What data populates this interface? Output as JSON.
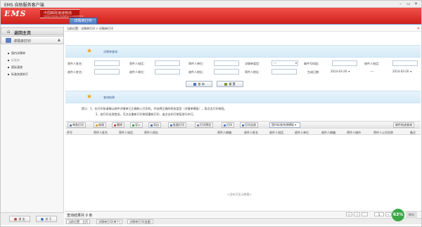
{
  "window": {
    "title": "EMS 自助服务客户端",
    "controls": [
      "–",
      "▭",
      "✕"
    ]
  },
  "header": {
    "logo_text": "EMS",
    "logo_cn": "中国邮政速递物流",
    "logo_en": "CHINA POSTAL EXPRESS & LOGISTICS",
    "main_tab": "详情单打印"
  },
  "sidebar": {
    "home_label": "返回主页",
    "section_label": "详情单打印",
    "items": [
      {
        "label": "国内详情单"
      },
      {
        "label": "标准快"
      },
      {
        "label": "国际速递"
      },
      {
        "label": "标准快递补打"
      }
    ],
    "exit_label": "退 出",
    "about_label": "关 于"
  },
  "breadcrumb": {
    "text": "当前位置：详情单打印 > 详情单打印"
  },
  "query_panel": {
    "title": "详情单查询"
  },
  "form": {
    "row1": [
      {
        "label": "寄件人姓名："
      },
      {
        "label": "寄件人电话："
      },
      {
        "label": "寄件人单位："
      },
      {
        "label": "详情单类型：",
        "select_value": "---"
      },
      {
        "label": "邮件号码段："
      },
      {
        "label": "收件人电话："
      }
    ],
    "row2": [
      {
        "label": "收件人姓名："
      },
      {
        "label": "收件人单位："
      },
      {
        "label": "收件人地址："
      },
      {
        "label": "寄件人地址："
      },
      {
        "label": "生成日期：",
        "date_from": "2014-03-26",
        "separator": "----",
        "date_to": "2014-03-26"
      }
    ],
    "query_label": "查 询",
    "reset_label": "重 置"
  },
  "list_panel": {
    "title": "查询结果"
  },
  "notice": {
    "line1": "提示：1、在打印前请确认邮件详情单已正确装入打印机，并选择正确的纸张类型（详情单模板），再点击打印按钮。",
    "line2": "2、若打印出现错误，可点击重新打印按钮重新打印，或点击补打按钮进行补打。"
  },
  "toolbar": {
    "buttons": [
      "单条打印",
      "修改",
      "删除",
      "导入",
      "导出",
      "批量打印",
      "打印预览",
      "打印",
      "打印全部"
    ],
    "template_select": "国内标准快递模板",
    "right_button": "邮件轨迹查询"
  },
  "grid": {
    "columns": [
      "序号",
      "寄件人姓名",
      "寄件人电话",
      "寄件人地址",
      "寄件人邮编",
      "收件人姓名",
      "收件人电话",
      "收件人单位",
      "收件人邮编",
      "寄件人城市",
      "寄件人公司名称",
      "备注"
    ],
    "empty_text": "<没有可显示数据>"
  },
  "status": {
    "text": "查询结果共 0 条",
    "page": "1"
  },
  "bottom_tabs": [
    "当前位置：主页",
    "详情单打印(单个)",
    "详情单打印(批量)"
  ],
  "float_badge": {
    "label": "63%",
    "side": "0K/s"
  }
}
